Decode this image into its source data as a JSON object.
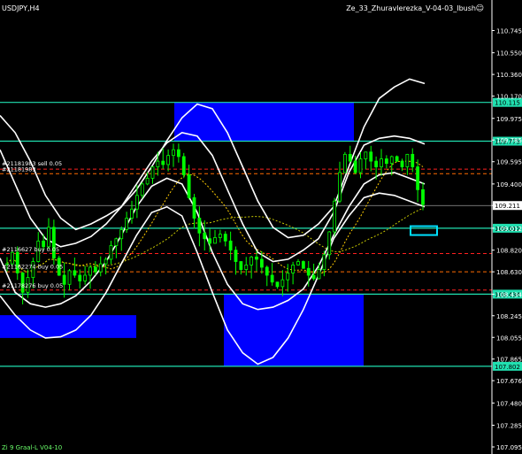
{
  "header": {
    "symbol_timeframe": "USDJPY,H4",
    "expert_label": "Ze_33_Zhuravlerezka_V-04-03_Ibush",
    "expert_status_icon": "smiley-icon"
  },
  "indicator_label": "Zi 9 Graal-L V04-10",
  "colors": {
    "background": "#000000",
    "candles": "#00ff00",
    "bands": "#ffffff",
    "levels": "#20e0b0",
    "zones": "#0000ff",
    "price_tag": "#ffffff",
    "selection_box": "#00e0ff"
  },
  "chart_data": {
    "type": "candlestick",
    "symbol": "USDJPY",
    "timeframe": "H4",
    "ylim": [
      107.095,
      110.935
    ],
    "price_ticks": [
      "110.745",
      "110.550",
      "110.360",
      "110.170",
      "109.975",
      "109.785",
      "109.595",
      "109.400",
      "109.211",
      "109.012",
      "108.820",
      "108.630",
      "108.434",
      "108.245",
      "108.055",
      "107.865",
      "107.676",
      "107.480",
      "107.285",
      "107.095"
    ],
    "current_price": "109.211",
    "levels": [
      {
        "price": 110.115,
        "label": "110.115"
      },
      {
        "price": 109.775,
        "label": "109.775"
      },
      {
        "price": 109.012,
        "label": "109.012"
      },
      {
        "price": 108.434,
        "label": "108.434"
      },
      {
        "price": 107.802,
        "label": "107.802"
      }
    ],
    "dashed_levels": [
      109.53,
      109.49,
      108.79,
      108.63,
      108.47
    ],
    "order_labels": [
      {
        "text": "#21181983 sell 0.05",
        "price": 109.56
      },
      {
        "text": "#21181983",
        "price": 109.51
      },
      {
        "text": "#2116627 buy 0.05",
        "price": 108.81
      },
      {
        "text": "#21162274 buy 0.05",
        "price": 108.66
      },
      {
        "text": "#21178276 buy 0.05",
        "price": 108.49
      }
    ],
    "closes": [
      108.7,
      108.8,
      108.62,
      108.45,
      108.58,
      108.72,
      108.9,
      108.85,
      109.02,
      108.75,
      108.6,
      108.52,
      108.64,
      108.6,
      108.55,
      108.6,
      108.67,
      108.63,
      108.7,
      108.74,
      108.86,
      108.92,
      109.0,
      109.1,
      109.18,
      109.3,
      109.4,
      109.45,
      109.55,
      109.6,
      109.57,
      109.65,
      109.7,
      109.64,
      109.48,
      109.28,
      109.1,
      108.97,
      108.92,
      108.88,
      108.93,
      108.96,
      108.9,
      108.82,
      108.72,
      108.65,
      108.69,
      108.76,
      108.74,
      108.67,
      108.6,
      108.54,
      108.5,
      108.56,
      108.62,
      108.69,
      108.72,
      108.66,
      108.6,
      108.57,
      108.65,
      108.78,
      108.98,
      109.25,
      109.5,
      109.66,
      109.6,
      109.5,
      109.62,
      109.68,
      109.6,
      109.55,
      109.62,
      109.58,
      109.64,
      109.6,
      109.55,
      109.66,
      109.55,
      109.35,
      109.22
    ],
    "bands": {
      "upper_outer": [
        110.0,
        109.85,
        109.6,
        109.3,
        109.1,
        109.0,
        109.05,
        109.12,
        109.2,
        109.35,
        109.55,
        109.78,
        109.98,
        110.1,
        110.06,
        109.85,
        109.55,
        109.25,
        109.02,
        108.93,
        108.95,
        109.05,
        109.2,
        109.55,
        109.9,
        110.15,
        110.25,
        110.32,
        110.28
      ],
      "upper_inner": [
        109.7,
        109.4,
        109.1,
        108.92,
        108.85,
        108.88,
        108.94,
        109.05,
        109.2,
        109.4,
        109.6,
        109.76,
        109.85,
        109.82,
        109.65,
        109.35,
        109.05,
        108.8,
        108.72,
        108.74,
        108.82,
        108.92,
        109.15,
        109.5,
        109.74,
        109.8,
        109.82,
        109.8,
        109.75
      ],
      "lower_inner": [
        108.75,
        108.45,
        108.35,
        108.32,
        108.35,
        108.42,
        108.55,
        108.72,
        108.95,
        109.2,
        109.38,
        109.45,
        109.4,
        109.15,
        108.8,
        108.52,
        108.35,
        108.3,
        108.32,
        108.38,
        108.48,
        108.68,
        108.95,
        109.2,
        109.4,
        109.48,
        109.5,
        109.45,
        109.4
      ],
      "lower_outer": [
        108.42,
        108.25,
        108.12,
        108.05,
        108.06,
        108.12,
        108.25,
        108.45,
        108.7,
        108.95,
        109.15,
        109.2,
        109.12,
        108.8,
        108.45,
        108.12,
        107.92,
        107.82,
        107.88,
        108.05,
        108.3,
        108.6,
        108.92,
        109.12,
        109.28,
        109.32,
        109.3,
        109.25,
        109.2
      ]
    }
  }
}
